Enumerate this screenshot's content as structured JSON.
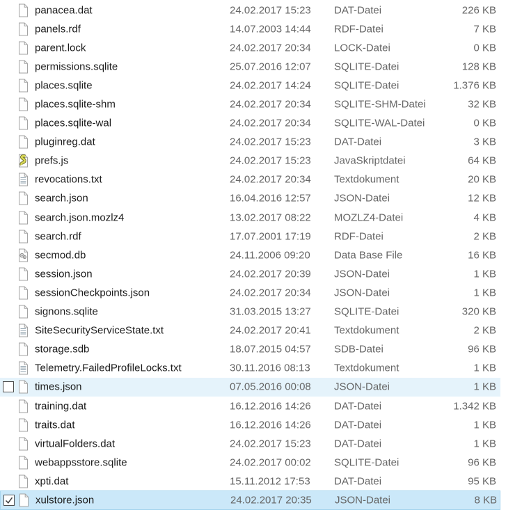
{
  "file_list": {
    "rows": [
      {
        "name": "panacea.dat",
        "date_modified": "24.02.2017 15:23",
        "type": "DAT-Datei",
        "size": "226 KB",
        "icon": "file",
        "state": "default",
        "checkbox": "none"
      },
      {
        "name": "panels.rdf",
        "date_modified": "14.07.2003 14:44",
        "type": "RDF-Datei",
        "size": "7 KB",
        "icon": "file",
        "state": "default",
        "checkbox": "none"
      },
      {
        "name": "parent.lock",
        "date_modified": "24.02.2017 20:34",
        "type": "LOCK-Datei",
        "size": "0 KB",
        "icon": "file",
        "state": "default",
        "checkbox": "none"
      },
      {
        "name": "permissions.sqlite",
        "date_modified": "25.07.2016 12:07",
        "type": "SQLITE-Datei",
        "size": "128 KB",
        "icon": "file",
        "state": "default",
        "checkbox": "none"
      },
      {
        "name": "places.sqlite",
        "date_modified": "24.02.2017 14:24",
        "type": "SQLITE-Datei",
        "size": "1.376 KB",
        "icon": "file",
        "state": "default",
        "checkbox": "none"
      },
      {
        "name": "places.sqlite-shm",
        "date_modified": "24.02.2017 20:34",
        "type": "SQLITE-SHM-Datei",
        "size": "32 KB",
        "icon": "file",
        "state": "default",
        "checkbox": "none"
      },
      {
        "name": "places.sqlite-wal",
        "date_modified": "24.02.2017 20:34",
        "type": "SQLITE-WAL-Datei",
        "size": "0 KB",
        "icon": "file",
        "state": "default",
        "checkbox": "none"
      },
      {
        "name": "pluginreg.dat",
        "date_modified": "24.02.2017 15:23",
        "type": "DAT-Datei",
        "size": "3 KB",
        "icon": "file",
        "state": "default",
        "checkbox": "none"
      },
      {
        "name": "prefs.js",
        "date_modified": "24.02.2017 15:23",
        "type": "JavaSkriptdatei",
        "size": "64 KB",
        "icon": "js",
        "state": "default",
        "checkbox": "none"
      },
      {
        "name": "revocations.txt",
        "date_modified": "24.02.2017 20:34",
        "type": "Textdokument",
        "size": "20 KB",
        "icon": "text",
        "state": "default",
        "checkbox": "none"
      },
      {
        "name": "search.json",
        "date_modified": "16.04.2016 12:57",
        "type": "JSON-Datei",
        "size": "12 KB",
        "icon": "file",
        "state": "default",
        "checkbox": "none"
      },
      {
        "name": "search.json.mozlz4",
        "date_modified": "13.02.2017 08:22",
        "type": "MOZLZ4-Datei",
        "size": "4 KB",
        "icon": "file",
        "state": "default",
        "checkbox": "none"
      },
      {
        "name": "search.rdf",
        "date_modified": "17.07.2001 17:19",
        "type": "RDF-Datei",
        "size": "2 KB",
        "icon": "file",
        "state": "default",
        "checkbox": "none"
      },
      {
        "name": "secmod.db",
        "date_modified": "24.11.2006 09:20",
        "type": "Data Base File",
        "size": "16 KB",
        "icon": "db",
        "state": "default",
        "checkbox": "none"
      },
      {
        "name": "session.json",
        "date_modified": "24.02.2017 20:39",
        "type": "JSON-Datei",
        "size": "1 KB",
        "icon": "file",
        "state": "default",
        "checkbox": "none"
      },
      {
        "name": "sessionCheckpoints.json",
        "date_modified": "24.02.2017 20:34",
        "type": "JSON-Datei",
        "size": "1 KB",
        "icon": "file",
        "state": "default",
        "checkbox": "none"
      },
      {
        "name": "signons.sqlite",
        "date_modified": "31.03.2015 13:27",
        "type": "SQLITE-Datei",
        "size": "320 KB",
        "icon": "file",
        "state": "default",
        "checkbox": "none"
      },
      {
        "name": "SiteSecurityServiceState.txt",
        "date_modified": "24.02.2017 20:41",
        "type": "Textdokument",
        "size": "2 KB",
        "icon": "text",
        "state": "default",
        "checkbox": "none"
      },
      {
        "name": "storage.sdb",
        "date_modified": "18.07.2015 04:57",
        "type": "SDB-Datei",
        "size": "96 KB",
        "icon": "file",
        "state": "default",
        "checkbox": "none"
      },
      {
        "name": "Telemetry.FailedProfileLocks.txt",
        "date_modified": "30.11.2016 08:13",
        "type": "Textdokument",
        "size": "1 KB",
        "icon": "text",
        "state": "default",
        "checkbox": "none"
      },
      {
        "name": "times.json",
        "date_modified": "07.05.2016 00:08",
        "type": "JSON-Datei",
        "size": "1 KB",
        "icon": "file",
        "state": "hover",
        "checkbox": "unchecked"
      },
      {
        "name": "training.dat",
        "date_modified": "16.12.2016 14:26",
        "type": "DAT-Datei",
        "size": "1.342 KB",
        "icon": "file",
        "state": "default",
        "checkbox": "none"
      },
      {
        "name": "traits.dat",
        "date_modified": "16.12.2016 14:26",
        "type": "DAT-Datei",
        "size": "1 KB",
        "icon": "file",
        "state": "default",
        "checkbox": "none"
      },
      {
        "name": "virtualFolders.dat",
        "date_modified": "24.02.2017 15:23",
        "type": "DAT-Datei",
        "size": "1 KB",
        "icon": "file",
        "state": "default",
        "checkbox": "none"
      },
      {
        "name": "webappsstore.sqlite",
        "date_modified": "24.02.2017 00:02",
        "type": "SQLITE-Datei",
        "size": "96 KB",
        "icon": "file",
        "state": "default",
        "checkbox": "none"
      },
      {
        "name": "xpti.dat",
        "date_modified": "15.11.2012 17:53",
        "type": "DAT-Datei",
        "size": "95 KB",
        "icon": "file",
        "state": "default",
        "checkbox": "none"
      },
      {
        "name": "xulstore.json",
        "date_modified": "24.02.2017 20:35",
        "type": "JSON-Datei",
        "size": "8 KB",
        "icon": "file",
        "state": "selected",
        "checkbox": "checked"
      }
    ]
  },
  "icon_names": {
    "file": "blank-file-icon",
    "js": "javascript-file-icon",
    "text": "text-document-icon",
    "db": "database-file-icon",
    "check": "checkmark-icon"
  },
  "colors": {
    "selected_row": "#cbe8f9",
    "selected_border": "#a9d6ef",
    "hover_row": "#e5f3fb",
    "name_text": "#1c1c1c",
    "secondary_text": "#666666",
    "icon_outline": "#a3a3a3",
    "js_icon_fill": "#d8d855",
    "background": "#ffffff"
  }
}
